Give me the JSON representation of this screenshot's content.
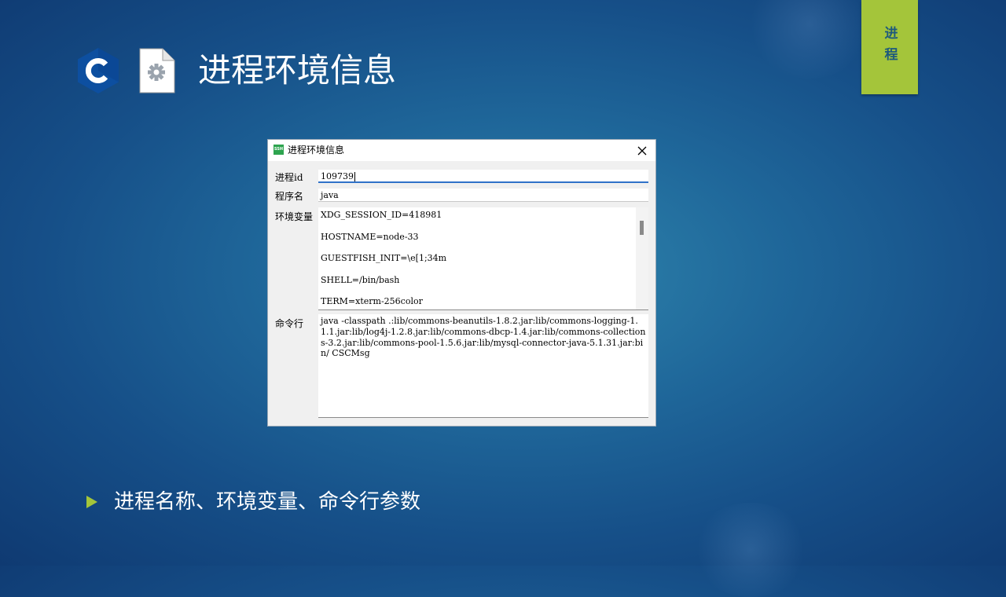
{
  "slide": {
    "title": "进程环境信息",
    "side_tab": "进程",
    "bullet": "进程名称、环境变量、命令行参数",
    "icons": {
      "logo": "c-language-hexagon-icon",
      "file": "settings-file-icon",
      "bullet": "triangle-bullet-icon"
    },
    "colors": {
      "accent": "#a4c53a",
      "logo": "#0d4fa0",
      "tab_text": "#1e5a7c"
    }
  },
  "dialog": {
    "title": "进程环境信息",
    "app_icon_text": "SSH",
    "close_icon": "close-icon",
    "fields": {
      "pid_label": "进程id",
      "pid_value": "109739",
      "name_label": "程序名",
      "name_value": "java",
      "env_label": "环境变量",
      "cmd_label": "命令行"
    },
    "env_vars": [
      "XDG_SESSION_ID=418981",
      "HOSTNAME=node-33",
      "GUESTFISH_INIT=\\e[1;34m",
      "SHELL=/bin/bash",
      "TERM=xterm-256color"
    ],
    "cmdline": "java -classpath .:lib/commons-beanutils-1.8.2.jar:lib/commons-logging-1.1.1.jar:lib/log4j-1.2.8.jar:lib/commons-dbcp-1.4.jar:lib/commons-collections-3.2.jar:lib/commons-pool-1.5.6.jar:lib/mysql-connector-java-5.1.31.jar:bin/ CSCMsg"
  }
}
